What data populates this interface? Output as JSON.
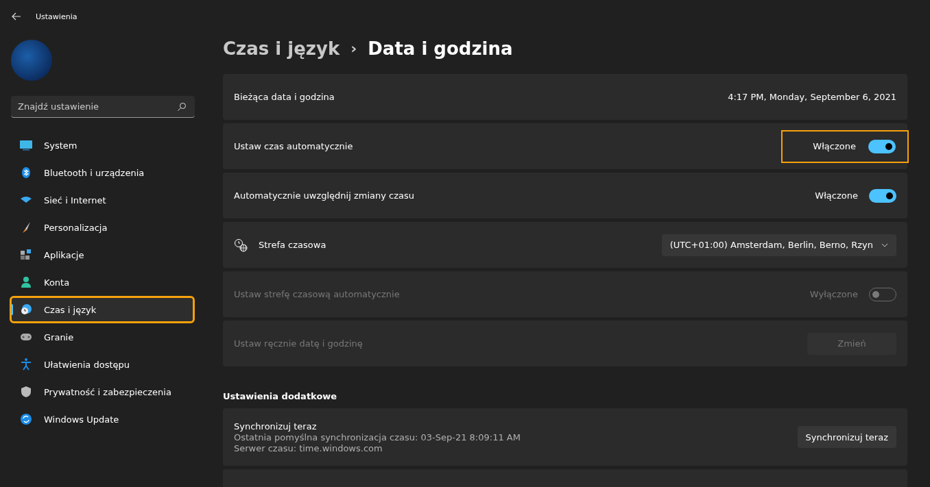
{
  "window": {
    "title": "Ustawienia"
  },
  "search": {
    "placeholder": "Znajdź ustawienie"
  },
  "sidebar": {
    "items": [
      {
        "label": "System",
        "selected": false,
        "highlighted": false
      },
      {
        "label": "Bluetooth i urządzenia",
        "selected": false,
        "highlighted": false
      },
      {
        "label": "Sieć i Internet",
        "selected": false,
        "highlighted": false
      },
      {
        "label": "Personalizacja",
        "selected": false,
        "highlighted": false
      },
      {
        "label": "Aplikacje",
        "selected": false,
        "highlighted": false
      },
      {
        "label": "Konta",
        "selected": false,
        "highlighted": false
      },
      {
        "label": "Czas i język",
        "selected": true,
        "highlighted": true
      },
      {
        "label": "Granie",
        "selected": false,
        "highlighted": false
      },
      {
        "label": "Ułatwienia dostępu",
        "selected": false,
        "highlighted": false
      },
      {
        "label": "Prywatność i zabezpieczenia",
        "selected": false,
        "highlighted": false
      },
      {
        "label": "Windows Update",
        "selected": false,
        "highlighted": false
      }
    ]
  },
  "breadcrumb": {
    "parent": "Czas i język",
    "separator": "›",
    "current": "Data i godzina"
  },
  "rows": [
    {
      "kind": "value",
      "label": "Bieżąca data i godzina",
      "value": "4:17 PM, Monday, September 6, 2021",
      "disabled": false,
      "highlighted": false
    },
    {
      "kind": "toggle",
      "label": "Ustaw czas automatycznie",
      "state_text": "Włączone",
      "on": true,
      "disabled": false,
      "highlighted": true
    },
    {
      "kind": "toggle",
      "label": "Automatycznie uwzględnij zmiany czasu",
      "state_text": "Włączone",
      "on": true,
      "disabled": false,
      "highlighted": false
    },
    {
      "kind": "select",
      "label": "Strefa czasowa",
      "value": "(UTC+01:00) Amsterdam, Berlin, Berno, Rzyn",
      "disabled": false,
      "highlighted": false
    },
    {
      "kind": "toggle",
      "label": "Ustaw strefę czasową automatycznie",
      "state_text": "Wyłączone",
      "on": false,
      "disabled": true,
      "highlighted": false
    },
    {
      "kind": "button",
      "label": "Ustaw ręcznie datę i godzinę",
      "button": "Zmień",
      "disabled": true,
      "highlighted": false
    }
  ],
  "additional": {
    "heading": "Ustawienia dodatkowe",
    "sync": {
      "title": "Synchronizuj teraz",
      "last_sync": "Ostatnia pomyślna synchronizacja czasu: 03-Sep-21 8:09:11 AM",
      "server": "Serwer czasu: time.windows.com",
      "button": "Synchronizuj teraz"
    }
  }
}
